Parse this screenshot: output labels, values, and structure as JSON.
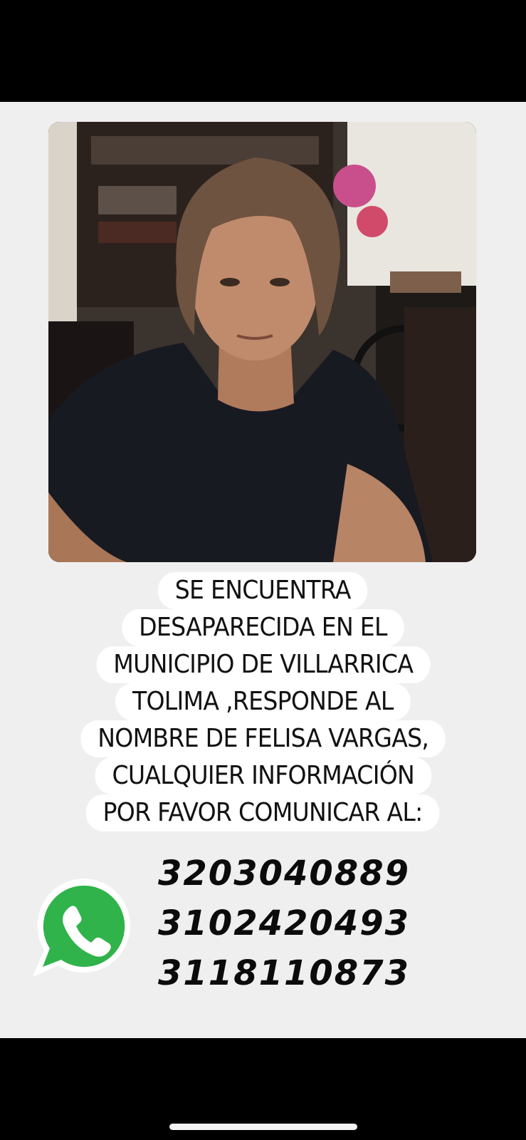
{
  "poster": {
    "photo_alt": "",
    "message_lines": [
      "SE ENCUENTRA",
      "DESAPARECIDA EN EL",
      "MUNICIPIO DE VILLARRICA",
      "TOLIMA  ,RESPONDE AL",
      "NOMBRE DE FELISA VARGAS,",
      "CUALQUIER INFORMACIÓN",
      "POR FAVOR COMUNICAR AL:"
    ],
    "phones": [
      "3203040889",
      "3102420493",
      "3118110873"
    ],
    "icons": {
      "contact": "whatsapp-icon"
    },
    "colors": {
      "background": "#efefef",
      "whatsapp_green": "#2fb34a",
      "text": "#111111",
      "highlight": "#ffffff"
    }
  }
}
